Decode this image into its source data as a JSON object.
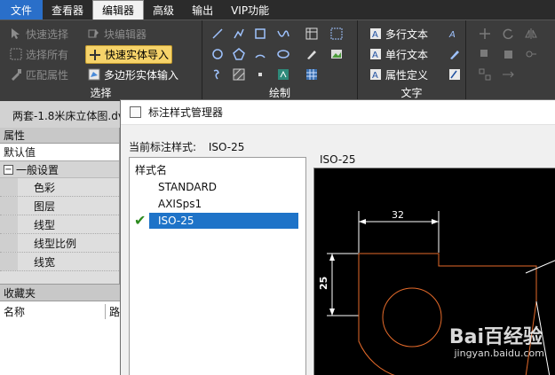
{
  "menubar": {
    "items": [
      "文件",
      "查看器",
      "编辑器",
      "高级",
      "输出",
      "VIP功能"
    ],
    "active_index": 2
  },
  "ribbon": {
    "select_group": {
      "caption": "选择",
      "buttons": [
        "快速选择",
        "选择所有",
        "匹配属性"
      ]
    },
    "editor_group": {
      "buttons": [
        "块编辑器",
        "快速实体导入",
        "多边形实体输入"
      ]
    },
    "draw_group": {
      "caption": "绘制"
    },
    "text_group": {
      "caption": "文字",
      "buttons": [
        "多行文本",
        "单行文本",
        "属性定义"
      ]
    },
    "accent_color": "#f6d36a"
  },
  "doc_tab": {
    "title": "两套-1.8米床立体图.dv"
  },
  "left_panel": {
    "header": "属性",
    "combo_value": "默认值",
    "group_title": "一般设置",
    "properties": [
      "色彩",
      "图层",
      "线型",
      "线型比例",
      "线宽"
    ],
    "favorites_header": "收藏夹",
    "favorites_columns": [
      "名称",
      "路"
    ]
  },
  "dialog": {
    "title": "标注样式管理器",
    "current_style_label": "当前标注样式:",
    "current_style_value": "ISO-25",
    "list_header": "样式名",
    "styles": [
      "STANDARD",
      "AXISps1",
      "ISO-25"
    ],
    "selected_style": "ISO-25",
    "preview_title": "ISO-25",
    "preview_dims": {
      "horizontal": "32",
      "vertical": "25"
    }
  },
  "watermark": {
    "text": "Bai百经验",
    "url": "jingyan.baidu.com"
  }
}
